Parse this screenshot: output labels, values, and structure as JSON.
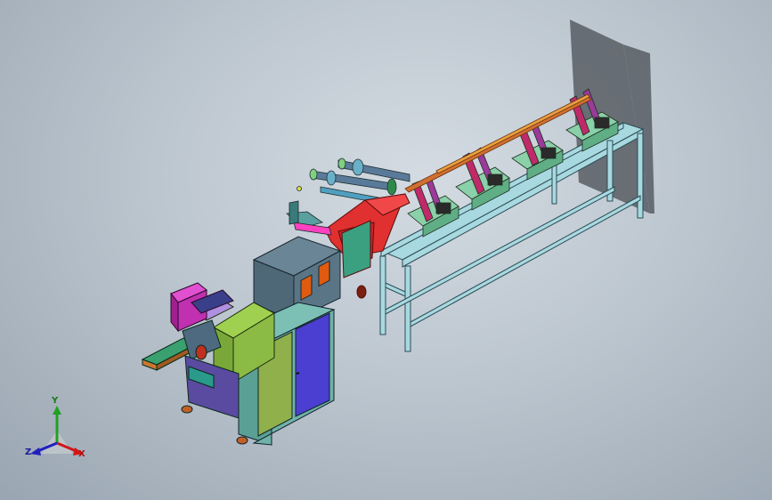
{
  "viewport": {
    "background_top": "#d4dbe2",
    "background_bottom": "#99a5b1"
  },
  "triad": {
    "x_label": "X",
    "y_label": "Y",
    "z_label": "Z",
    "x_color": "#d01818",
    "y_color": "#22a022",
    "z_color": "#2020c0"
  },
  "model": {
    "frame_color": "#a8d8e0",
    "cabinet_color": "#6fb2a8",
    "door_left_color": "#8fb04a",
    "door_right_color": "#4a3fd0",
    "top_box_color": "#5a7585",
    "feeder_color": "#e03030",
    "magenta_unit_color": "#c030b0",
    "conveyor_color": "#3aa070",
    "rail_color": "#d07030"
  }
}
